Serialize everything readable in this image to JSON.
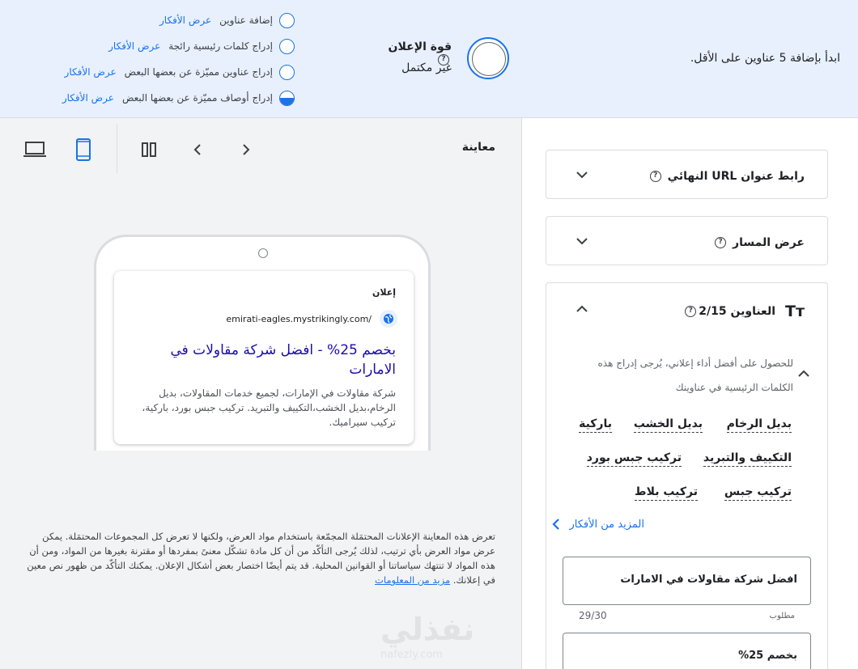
{
  "banner": {
    "message": "ابدأ بإضافة 5 عناوين على الأقل.",
    "strength_title": "قوة الإعلان",
    "strength_status": "غير مكتمل",
    "help_symbol": "?",
    "tips": [
      {
        "text": "إضافة عناوين",
        "link": "عرض الأفكار",
        "state": "empty"
      },
      {
        "text": "إدراج كلمات رئيسية رائجة",
        "link": "عرض الأفكار",
        "state": "empty"
      },
      {
        "text": "إدراج عناوين مميّزة عن بعضها البعض",
        "link": "عرض الأفكار",
        "state": "empty"
      },
      {
        "text": "إدراج أوصاف مميّزة عن بعضها البعض",
        "link": "عرض الأفكار",
        "state": "half"
      }
    ]
  },
  "preview": {
    "title": "معاينة",
    "icons": [
      "desktop-icon",
      "mobile-icon",
      "columns-icon",
      "prev-icon",
      "next-icon"
    ],
    "ad": {
      "label": "إعلان",
      "url": "emirati-eagles.mystrikingly.com/",
      "headline": "بخصم 25% - افضل شركة مقاولات في الامارات",
      "description": "شركة مقاولات في الإمارات، لجميع خدمات المقاولات، بديل الرخام،بديل الخشب،التكييف والتبريد. تركيب جبس بورد، باركية، تركيب سيراميك."
    },
    "disclaimer": "تعرض هذه المعاينة الإعلانات المحتمَلة المجمّعة باستخدام مواد العرض، ولكنها لا تعرض كل المجموعات المحتمَلة. يمكن عرض مواد العرض بأي ترتيب، لذلك يُرجى التأكّد من أن كل مادة تشكّل معنىً بمفردها أو مقترنة بغيرها من المواد، ومن أن هذه المواد لا تنتهك سياساتنا أو القوانين المحلية. قد يتم أيضًا اختصار بعض أشكال الإعلان. يمكنك التأكّد من ظهور نص معين في إعلانك.",
    "disclaimer_link": "مزيد من المعلومات",
    "watermark": "نفذلي",
    "watermark_sub": "nafezly.com"
  },
  "editor": {
    "final_url_title": "رابط عنوان URL النهائي",
    "path_title": "عرض المسار",
    "headlines_title": "العناوين 2/15",
    "headlines_icon": "Tт",
    "keywords_hint": "للحصول على أفضل أداء إعلاني، يُرجى إدراج هذه الكلمات الرئيسية في عناوينك",
    "keywords": [
      "بديل الرخام",
      "بديل الخشب",
      "باركية",
      "التكييف والتبريد",
      "تركيب جبس بورد",
      "تركيب جبس",
      "تركيب بلاط"
    ],
    "more_ideas": "المزيد من الأفكار",
    "fields": [
      {
        "value": "افضل شركة مقاولات في الامارات",
        "required": "مطلوب",
        "count": "29/30"
      },
      {
        "value": "بخصم 25%",
        "required": "",
        "count": ""
      }
    ]
  },
  "colors": {
    "accent": "#1a73e8",
    "banner_bg": "#e8f0fe",
    "preview_bg": "#f1f3f4"
  }
}
